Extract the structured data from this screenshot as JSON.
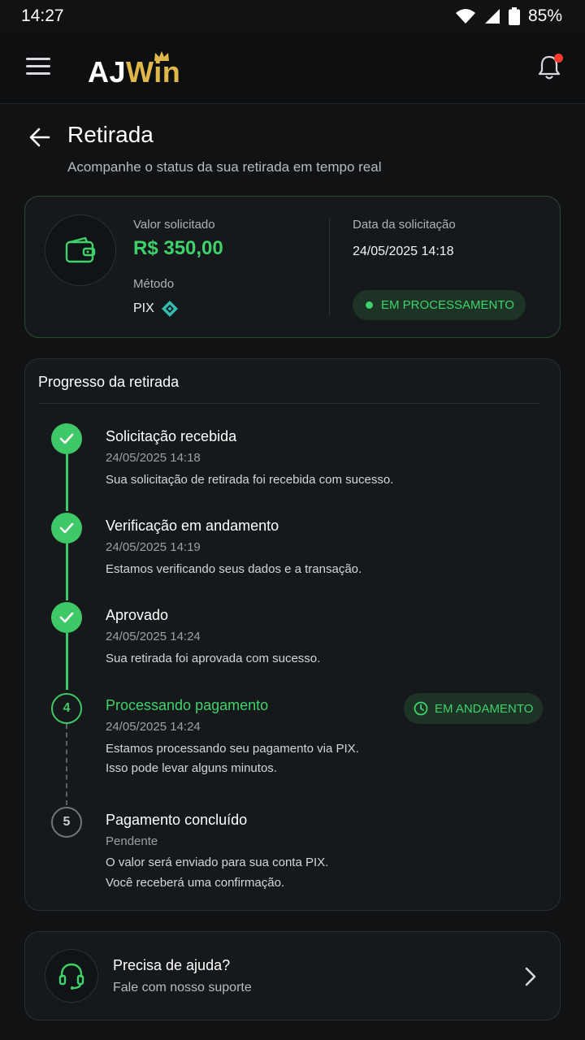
{
  "status_bar": {
    "time": "14:27",
    "battery": "85%"
  },
  "header": {
    "logo_part1": "AJ",
    "logo_part2": "Win",
    "icons": [
      "menu-icon",
      "crown-icon",
      "bell-icon"
    ],
    "notification_dot_color": "#ff3b30"
  },
  "page": {
    "title": "Retirada",
    "subtitle": "Acompanhe o status da sua retirada em tempo real"
  },
  "summary": {
    "amount_label": "Valor solicitado",
    "amount": "R$ 350,00",
    "method_label": "Método",
    "method": "PIX",
    "date_label": "Data da solicitação",
    "date": "24/05/2025 14:18",
    "status": "EM PROCESSAMENTO"
  },
  "progress": {
    "title": "Progresso da retirada",
    "steps": [
      {
        "state": "done",
        "title": "Solicitação recebida",
        "date": "24/05/2025 14:18",
        "desc": [
          "Sua solicitação de retirada foi recebida com sucesso."
        ]
      },
      {
        "state": "done",
        "title": "Verificação em andamento",
        "date": "24/05/2025 14:19",
        "desc": [
          "Estamos verificando seus dados e a transação."
        ]
      },
      {
        "state": "done",
        "title": "Aprovado",
        "date": "24/05/2025 14:24",
        "desc": [
          "Sua retirada foi aprovada com sucesso."
        ]
      },
      {
        "state": "current",
        "number": "4",
        "title": "Processando pagamento",
        "date": "24/05/2025 14:24",
        "badge": "EM ANDAMENTO",
        "desc": [
          "Estamos processando seu pagamento via PIX.",
          "Isso pode levar alguns minutos."
        ]
      },
      {
        "state": "pending",
        "number": "5",
        "title": "Pagamento concluído",
        "date": "Pendente",
        "desc": [
          "O valor será enviado para sua conta PIX.",
          "Você receberá uma confirmação."
        ]
      }
    ]
  },
  "help": {
    "title": "Precisa de ajuda?",
    "subtitle": "Fale com nosso suporte"
  },
  "colors": {
    "accent": "#3fd26b",
    "gold": "#e0b84a",
    "background": "#101214",
    "card": "#16191c"
  }
}
